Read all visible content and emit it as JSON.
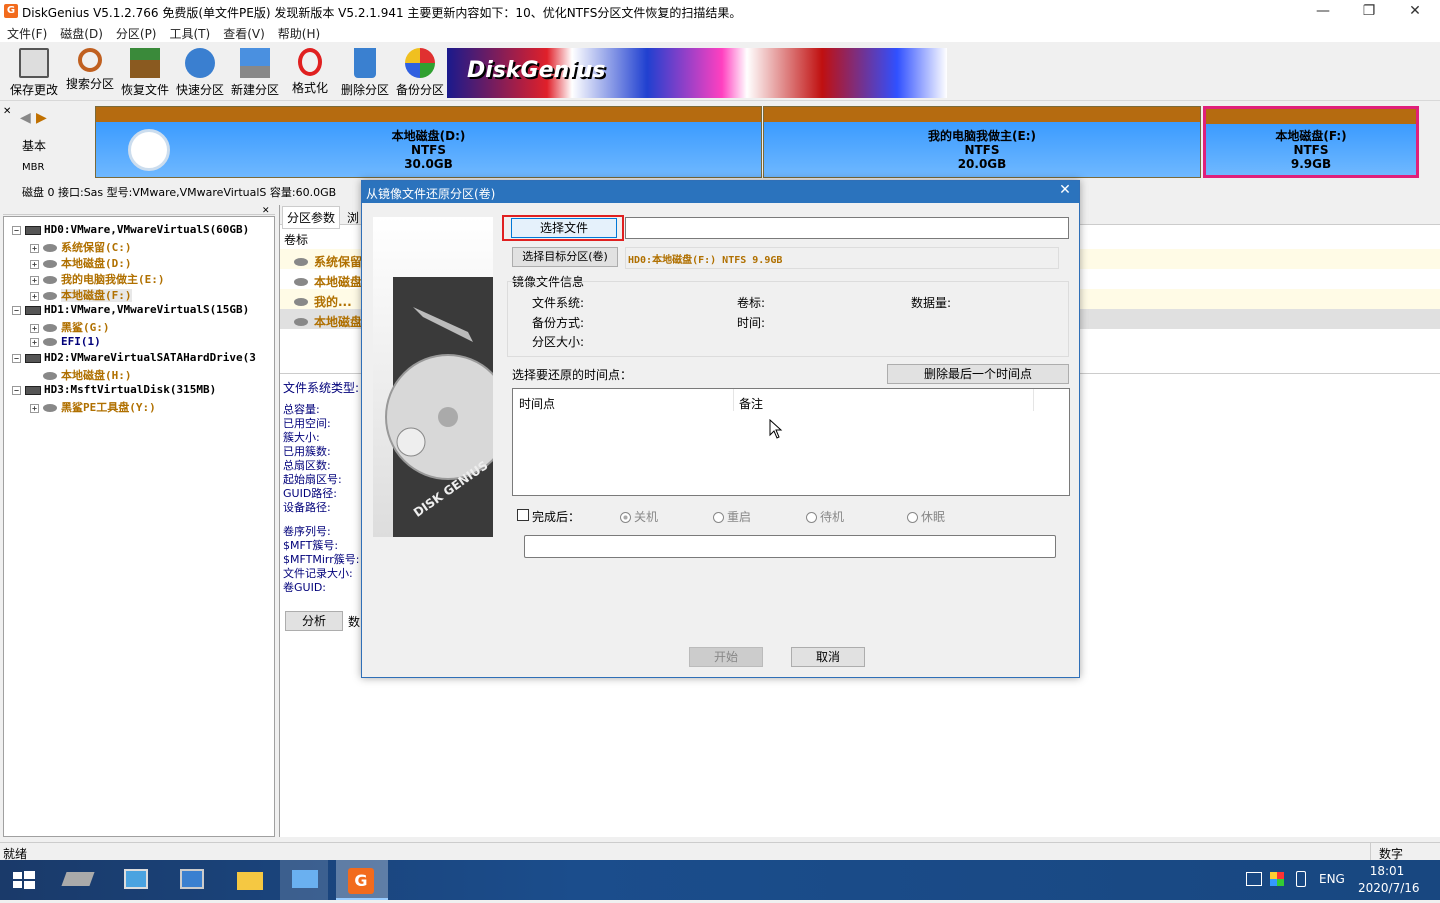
{
  "title": "DiskGenius V5.1.2.766 免费版(单文件PE版)   发现新版本 V5.2.1.941 主要更新内容如下：10、优化NTFS分区文件恢复的扫描结果。",
  "menu": [
    "文件(F)",
    "磁盘(D)",
    "分区(P)",
    "工具(T)",
    "查看(V)",
    "帮助(H)"
  ],
  "toolbar": [
    "保存更改",
    "搜索分区",
    "恢复文件",
    "快速分区",
    "新建分区",
    "格式化",
    "删除分区",
    "备份分区"
  ],
  "banner": {
    "text": "DiskGenius"
  },
  "disk_nav": {
    "type": "基本",
    "style": "MBR"
  },
  "partitions": [
    {
      "name": "本地磁盘(D:)",
      "fs": "NTFS",
      "size": "30.0GB"
    },
    {
      "name": "我的电脑我做主(E:)",
      "fs": "NTFS",
      "size": "20.0GB"
    },
    {
      "name": "本地磁盘(F:)",
      "fs": "NTFS",
      "size": "9.9GB"
    }
  ],
  "disk_info": "磁盘 0 接口:Sas  型号:VMware,VMwareVirtualS  容量:60.0GB",
  "tree": [
    {
      "label": "HD0:VMware,VMwareVirtualS(60GB)",
      "level": 0,
      "color": "#000"
    },
    {
      "label": "系统保留(C:)",
      "level": 1,
      "color": "#b07000"
    },
    {
      "label": "本地磁盘(D:)",
      "level": 1,
      "color": "#b07000"
    },
    {
      "label": "我的电脑我做主(E:)",
      "level": 1,
      "color": "#b07000"
    },
    {
      "label": "本地磁盘(F:)",
      "level": 1,
      "color": "#b07000",
      "selected": true
    },
    {
      "label": "HD1:VMware,VMwareVirtualS(15GB)",
      "level": 0,
      "color": "#000"
    },
    {
      "label": "黑鲨(G:)",
      "level": 1,
      "color": "#b07000"
    },
    {
      "label": "EFI(1)",
      "level": 1,
      "color": "#00007a"
    },
    {
      "label": "HD2:VMwareVirtualSATAHardDrive(3",
      "level": 0,
      "color": "#000"
    },
    {
      "label": "本地磁盘(H:)",
      "level": 1,
      "color": "#b07000"
    },
    {
      "label": "HD3:MsftVirtualDisk(315MB)",
      "level": 0,
      "color": "#000"
    },
    {
      "label": "黑鲨PE工具盘(Y:)",
      "level": 1,
      "color": "#b07000"
    }
  ],
  "right_panel": {
    "tabs": [
      "分区参数",
      "浏"
    ],
    "vol_header": "卷标",
    "vols": [
      "系统保留",
      "本地磁盘",
      "我的...",
      "本地磁盘"
    ],
    "fs_type_label": "文件系统类型:",
    "props": [
      "总容量:",
      "已用空间:",
      "簇大小:",
      "已用簇数:",
      "总扇区数:",
      "起始扇区号:",
      "GUID路径:",
      "设备路径:"
    ],
    "props2": [
      "卷序列号:",
      "$MFT簇号:",
      "$MFTMirr簇号:",
      "文件记录大小:",
      "卷GUID:"
    ],
    "analyze_btn": "分析",
    "data_lbl": "数"
  },
  "status": {
    "left": "就绪",
    "right": "数字"
  },
  "taskbar": {
    "ime": "ENG",
    "time": "18:01",
    "date": "2020/7/16"
  },
  "dialog": {
    "title": "从镜像文件还原分区(卷)",
    "choose_file": "选择文件",
    "file_path": "",
    "choose_target": "选择目标分区(卷)",
    "target_value": "HD0:本地磁盘(F:) NTFS 9.9GB",
    "image_info": "镜像文件信息",
    "fs_label": "文件系统:",
    "vol_label": "卷标:",
    "data_label": "数据量:",
    "backup_method": "备份方式:",
    "time_label": "时间:",
    "part_size": "分区大小:",
    "select_time": "选择要还原的时间点：",
    "delete_last": "删除最后一个时间点",
    "col_time": "时间点",
    "col_note": "备注",
    "after_done": "完成后：",
    "opts": [
      "关机",
      "重启",
      "待机",
      "休眠"
    ],
    "progress": "",
    "start": "开始",
    "cancel": "取消",
    "side_brand": "DISK GENIUS"
  }
}
